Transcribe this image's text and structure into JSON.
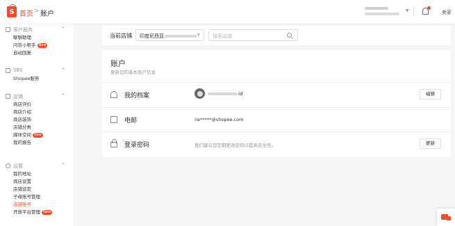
{
  "header": {
    "logo_letter": "S",
    "home_label": "首页",
    "separator": ">",
    "current_page": "账户",
    "notification_icon": "bell-icon",
    "right_label": "卖家"
  },
  "sidebar": {
    "sections": [
      {
        "title": "客户服务",
        "icon": "customer-service-icon",
        "items": [
          {
            "label": "聊聊助理"
          },
          {
            "label": "问答小帮手",
            "badge": "New"
          },
          {
            "label": "自动回复"
          }
        ]
      },
      {
        "title": "SBS",
        "icon": "sbs-icon",
        "items": [
          {
            "label": "Shopee服务"
          }
        ]
      },
      {
        "title": "店铺",
        "icon": "shop-icon",
        "items": [
          {
            "label": "商店评价"
          },
          {
            "label": "商店介绍"
          },
          {
            "label": "商店装饰"
          },
          {
            "label": "店铺分类"
          },
          {
            "label": "媒体空间",
            "badge": "New"
          },
          {
            "label": "我的报告"
          }
        ]
      },
      {
        "title": "设置",
        "icon": "settings-icon",
        "items": [
          {
            "label": "我的地址"
          },
          {
            "label": "商店设置"
          },
          {
            "label": "店铺设定"
          },
          {
            "label": "子母账号管理"
          },
          {
            "label": "店铺账号",
            "active": true
          },
          {
            "label": "开放平台管理",
            "badge": "New"
          }
        ]
      }
    ]
  },
  "store_filter": {
    "label": "当前店铺",
    "selected_prefix": "印度尼西亚",
    "search_placeholder": "搜索店铺"
  },
  "account": {
    "title": "账户",
    "subtitle": "更新您的基本账户信息",
    "rows": [
      {
        "label": "我的档案",
        "icon": "user-icon",
        "value": "id",
        "button": "编辑"
      },
      {
        "label": "电邮",
        "icon": "mail-icon",
        "value": "ne*****@shopee.com"
      },
      {
        "label": "登录密码",
        "icon": "lock-icon",
        "value": "我们建议您定期更改密码以提高安全性。",
        "button": "更新"
      }
    ]
  },
  "colors": {
    "accent": "#ee4d2d",
    "background": "#f6f6f6"
  }
}
